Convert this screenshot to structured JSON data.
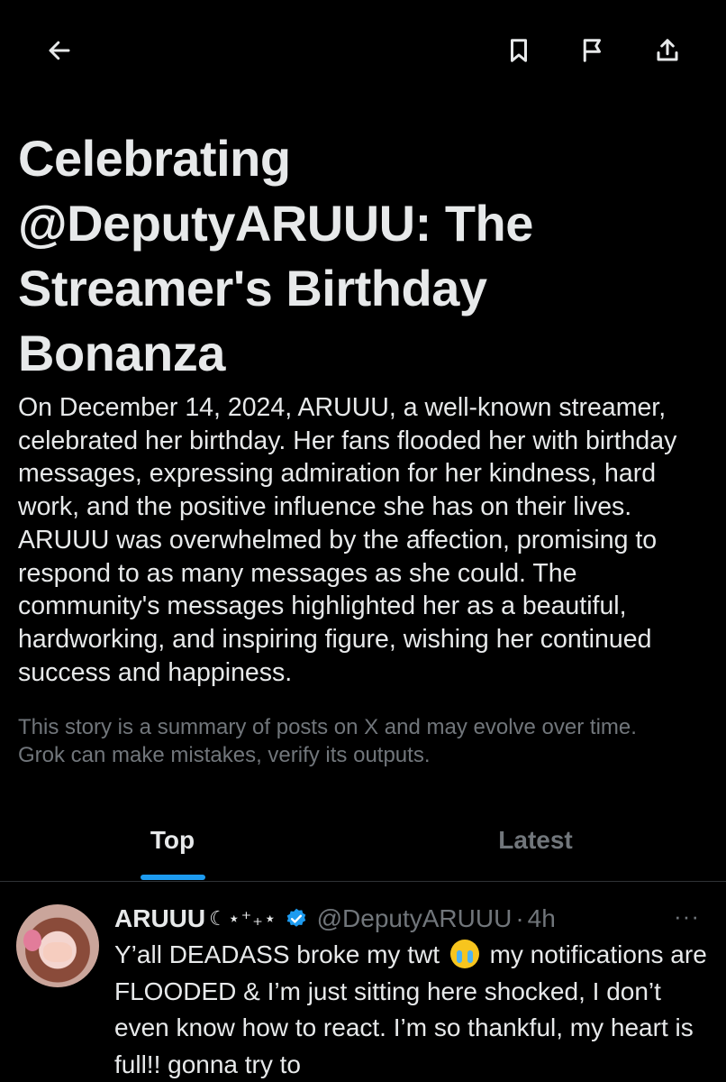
{
  "toolbar": {
    "back_icon": "arrow-left-icon",
    "bookmark_icon": "bookmark-icon",
    "flag_icon": "flag-icon",
    "share_icon": "share-icon"
  },
  "article": {
    "headline": "Celebrating @DeputyARUUU: The Streamer's Birthday Bonanza",
    "summary": "On December 14, 2024, ARUUU, a well-known streamer, celebrated her birthday. Her fans flooded her with birthday messages, expressing admiration for her kindness, hard work, and the positive influence she has on their lives. ARUUU was overwhelmed by the affection, promising to respond to as many messages as she could. The community's messages highlighted her as a beautiful, hardworking, and inspiring figure, wishing her continued success and happiness.",
    "disclaimer": "This story is a summary of posts on X and may evolve over time. Grok can make mistakes, verify its outputs."
  },
  "tabs": [
    {
      "label": "Top",
      "active": true
    },
    {
      "label": "Latest",
      "active": false
    }
  ],
  "post": {
    "display_name": "ARUUU",
    "name_decoration": "☾⋆⁺₊⋆",
    "handle": "@DeputyARUUU",
    "separator": "·",
    "time": "4h",
    "more_label": "···",
    "body_part1": "Y’all DEADASS broke my twt",
    "emoji": "loudly-crying-face",
    "body_part2": "my notifications are FLOODED & I’m just sitting here shocked, I don’t even know how to react. I’m so thankful, my heart is full!! gonna try to",
    "verified_color": "#1d9bf0"
  },
  "colors": {
    "background": "#000000",
    "text": "#e7e9ea",
    "muted": "#71767b",
    "accent": "#1d9bf0",
    "divider": "#2f3336"
  }
}
